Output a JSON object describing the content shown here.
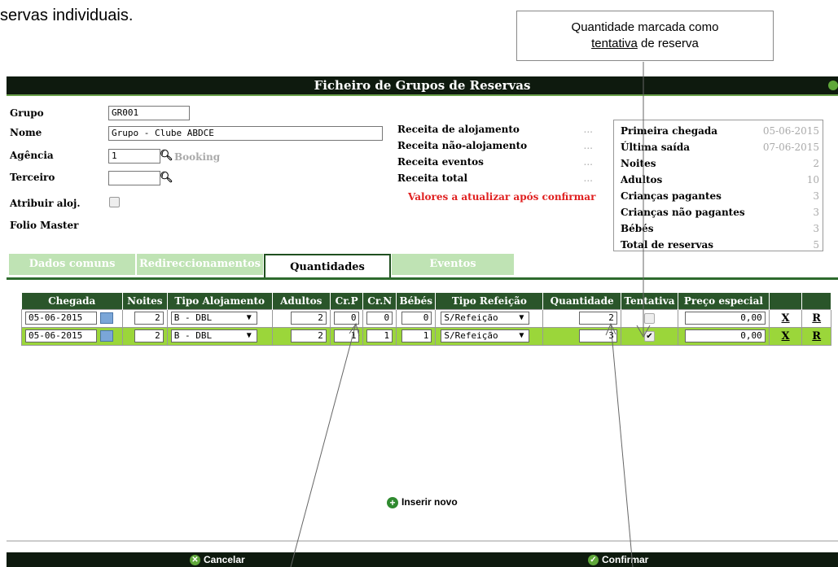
{
  "doc": {
    "text": "servas individuais."
  },
  "callout": {
    "line1": "Quantidade marcada como",
    "line2_underlined": "tentativa",
    "line2_rest": " de reserva"
  },
  "window": {
    "title": "Ficheiro de Grupos de Reservas"
  },
  "form": {
    "grupo_label": "Grupo",
    "grupo_value": "GR001",
    "nome_label": "Nome",
    "nome_value": "Grupo - Clube ABDCE",
    "agencia_label": "Agência",
    "agencia_value": "1",
    "agencia_name": "Booking",
    "terceiro_label": "Terceiro",
    "terceiro_value": "",
    "atribuir_label": "Atribuir aloj.",
    "folio_label": "Folio Master"
  },
  "receitas": {
    "items": [
      {
        "label": "Receita de alojamento",
        "value": "..."
      },
      {
        "label": "Receita não-alojamento",
        "value": "..."
      },
      {
        "label": "Receita eventos",
        "value": "..."
      },
      {
        "label": "Receita total",
        "value": "..."
      }
    ],
    "warning": "Valores a atualizar após confirmar"
  },
  "stats": [
    {
      "label": "Primeira chegada",
      "value": "05-06-2015"
    },
    {
      "label": "Última saída",
      "value": "07-06-2015"
    },
    {
      "label": "Noites",
      "value": "2"
    },
    {
      "label": "Adultos",
      "value": "10"
    },
    {
      "label": "Crianças pagantes",
      "value": "3"
    },
    {
      "label": "Crianças não pagantes",
      "value": "3"
    },
    {
      "label": "Bébés",
      "value": "3"
    },
    {
      "label": "Total de reservas",
      "value": "5"
    }
  ],
  "tabs": [
    "Dados comuns",
    "Redireccionamentos",
    "Quantidades",
    "Eventos"
  ],
  "grid": {
    "headers": [
      "Chegada",
      "Noites",
      "Tipo Alojamento",
      "Adultos",
      "Cr.P",
      "Cr.N",
      "Bébés",
      "Tipo Refeição",
      "Quantidade",
      "Tentativa",
      "Preço especial",
      "",
      ""
    ],
    "rows": [
      {
        "chegada": "05-06-2015",
        "noites": "2",
        "tipo": "B - DBL",
        "adultos": "2",
        "crp": "0",
        "crn": "0",
        "bebes": "0",
        "refeicao": "S/Refeição",
        "quantidade": "2",
        "tentativa": "",
        "preco": "0,00",
        "x": "X",
        "r": "R"
      },
      {
        "chegada": "05-06-2015",
        "noites": "2",
        "tipo": "B - DBL",
        "adultos": "2",
        "crp": "1",
        "crn": "1",
        "bebes": "1",
        "refeicao": "S/Refeição",
        "quantidade": "3",
        "tentativa": "✔",
        "preco": "0,00",
        "x": "X",
        "r": "R"
      }
    ]
  },
  "inserir": "Inserir novo",
  "footer": {
    "cancel": "Cancelar",
    "confirm": "Confirmar"
  },
  "colors": {
    "titlebar": "#0e1a0e",
    "header": "#2a552a",
    "selected_row": "#9bd63a",
    "tab_inactive": "#bfe3b4",
    "warning": "#e02020"
  }
}
